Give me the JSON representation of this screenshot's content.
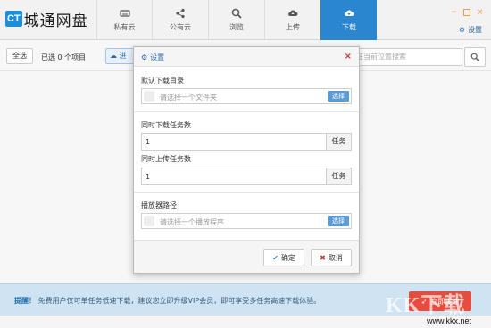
{
  "app": {
    "logo_badge": "CT",
    "logo_text": "城通网盘"
  },
  "tabs": [
    {
      "label": "私有云",
      "icon": "drive-icon"
    },
    {
      "label": "公有云",
      "icon": "share-icon"
    },
    {
      "label": "浏览",
      "icon": "search-icon"
    },
    {
      "label": "上传",
      "icon": "cloud-upload-icon"
    },
    {
      "label": "下载",
      "icon": "cloud-download-icon",
      "active": true
    }
  ],
  "header": {
    "settings_label": "设置"
  },
  "toolbar": {
    "select_all": "全选",
    "selected_text": "已选 0 个项目",
    "upload_label": "进",
    "search_placeholder": "在当前位置搜索"
  },
  "dialog": {
    "title": "设置",
    "download_dir_label": "默认下载目录",
    "download_dir_placeholder": "请选择一个文件夹",
    "download_dir_button": "选择",
    "concurrent_download_label": "同时下载任务数",
    "concurrent_download_value": "1",
    "concurrent_download_unit": "任务",
    "concurrent_upload_label": "同时上传任务数",
    "concurrent_upload_value": "1",
    "concurrent_upload_unit": "任务",
    "player_path_label": "播放器路径",
    "player_path_placeholder": "请选择一个播放程序",
    "player_path_button": "选择",
    "ok_label": "确定",
    "cancel_label": "取消"
  },
  "notice": {
    "prefix": "提醒！",
    "text": "免费用户仅可单任务低速下载，建议您立即升级VIP会员，即可享受多任务高速下载体验。",
    "button": "立即提速"
  },
  "watermark": {
    "text": "KK下载",
    "url": "www.kkx.net"
  },
  "colors": {
    "accent": "#2a86cf",
    "danger": "#e74c3c",
    "notice_bg": "#cfe3f3"
  }
}
